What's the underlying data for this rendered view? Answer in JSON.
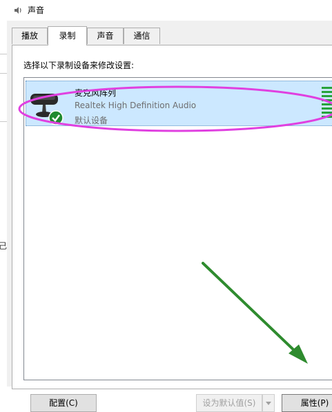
{
  "window": {
    "title": "声音"
  },
  "tabs": [
    {
      "label": "播放"
    },
    {
      "label": "录制"
    },
    {
      "label": "声音"
    },
    {
      "label": "通信"
    }
  ],
  "active_tab_index": 1,
  "panel": {
    "instruction": "选择以下录制设备来修改设置:"
  },
  "devices": [
    {
      "name": "麦克风阵列",
      "driver": "Realtek High Definition Audio",
      "status": "默认设备",
      "icon": "microphone-icon",
      "status_icon": "green-check-icon",
      "selected": true
    }
  ],
  "buttons": {
    "configure": "配置(C)",
    "set_default": "设为默认值(S)",
    "properties": "属性(P)"
  },
  "left_edge_glyph": "己",
  "colors": {
    "selection": "#cce8ff",
    "annotation_ellipse": "#e040e0",
    "annotation_arrow": "#2e8b2e",
    "level_meter": "#27a33a",
    "dialog_bg": "#f0f0f0"
  }
}
